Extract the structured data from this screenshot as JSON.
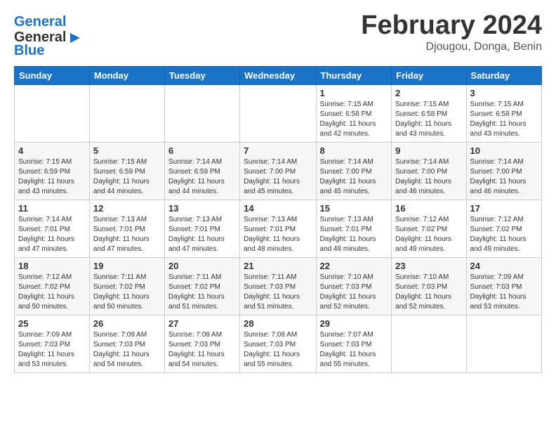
{
  "header": {
    "logo_general": "General",
    "logo_blue": "Blue",
    "month_title": "February 2024",
    "location": "Djougou, Donga, Benin"
  },
  "calendar": {
    "days_of_week": [
      "Sunday",
      "Monday",
      "Tuesday",
      "Wednesday",
      "Thursday",
      "Friday",
      "Saturday"
    ],
    "weeks": [
      [
        {
          "day": "",
          "info": ""
        },
        {
          "day": "",
          "info": ""
        },
        {
          "day": "",
          "info": ""
        },
        {
          "day": "",
          "info": ""
        },
        {
          "day": "1",
          "info": "Sunrise: 7:15 AM\nSunset: 6:58 PM\nDaylight: 11 hours and 42 minutes."
        },
        {
          "day": "2",
          "info": "Sunrise: 7:15 AM\nSunset: 6:58 PM\nDaylight: 11 hours and 43 minutes."
        },
        {
          "day": "3",
          "info": "Sunrise: 7:15 AM\nSunset: 6:58 PM\nDaylight: 11 hours and 43 minutes."
        }
      ],
      [
        {
          "day": "4",
          "info": "Sunrise: 7:15 AM\nSunset: 6:59 PM\nDaylight: 11 hours and 43 minutes."
        },
        {
          "day": "5",
          "info": "Sunrise: 7:15 AM\nSunset: 6:59 PM\nDaylight: 11 hours and 44 minutes."
        },
        {
          "day": "6",
          "info": "Sunrise: 7:14 AM\nSunset: 6:59 PM\nDaylight: 11 hours and 44 minutes."
        },
        {
          "day": "7",
          "info": "Sunrise: 7:14 AM\nSunset: 7:00 PM\nDaylight: 11 hours and 45 minutes."
        },
        {
          "day": "8",
          "info": "Sunrise: 7:14 AM\nSunset: 7:00 PM\nDaylight: 11 hours and 45 minutes."
        },
        {
          "day": "9",
          "info": "Sunrise: 7:14 AM\nSunset: 7:00 PM\nDaylight: 11 hours and 46 minutes."
        },
        {
          "day": "10",
          "info": "Sunrise: 7:14 AM\nSunset: 7:00 PM\nDaylight: 11 hours and 46 minutes."
        }
      ],
      [
        {
          "day": "11",
          "info": "Sunrise: 7:14 AM\nSunset: 7:01 PM\nDaylight: 11 hours and 47 minutes."
        },
        {
          "day": "12",
          "info": "Sunrise: 7:13 AM\nSunset: 7:01 PM\nDaylight: 11 hours and 47 minutes."
        },
        {
          "day": "13",
          "info": "Sunrise: 7:13 AM\nSunset: 7:01 PM\nDaylight: 11 hours and 47 minutes."
        },
        {
          "day": "14",
          "info": "Sunrise: 7:13 AM\nSunset: 7:01 PM\nDaylight: 11 hours and 48 minutes."
        },
        {
          "day": "15",
          "info": "Sunrise: 7:13 AM\nSunset: 7:01 PM\nDaylight: 11 hours and 48 minutes."
        },
        {
          "day": "16",
          "info": "Sunrise: 7:12 AM\nSunset: 7:02 PM\nDaylight: 11 hours and 49 minutes."
        },
        {
          "day": "17",
          "info": "Sunrise: 7:12 AM\nSunset: 7:02 PM\nDaylight: 11 hours and 49 minutes."
        }
      ],
      [
        {
          "day": "18",
          "info": "Sunrise: 7:12 AM\nSunset: 7:02 PM\nDaylight: 11 hours and 50 minutes."
        },
        {
          "day": "19",
          "info": "Sunrise: 7:11 AM\nSunset: 7:02 PM\nDaylight: 11 hours and 50 minutes."
        },
        {
          "day": "20",
          "info": "Sunrise: 7:11 AM\nSunset: 7:02 PM\nDaylight: 11 hours and 51 minutes."
        },
        {
          "day": "21",
          "info": "Sunrise: 7:11 AM\nSunset: 7:03 PM\nDaylight: 11 hours and 51 minutes."
        },
        {
          "day": "22",
          "info": "Sunrise: 7:10 AM\nSunset: 7:03 PM\nDaylight: 11 hours and 52 minutes."
        },
        {
          "day": "23",
          "info": "Sunrise: 7:10 AM\nSunset: 7:03 PM\nDaylight: 11 hours and 52 minutes."
        },
        {
          "day": "24",
          "info": "Sunrise: 7:09 AM\nSunset: 7:03 PM\nDaylight: 11 hours and 53 minutes."
        }
      ],
      [
        {
          "day": "25",
          "info": "Sunrise: 7:09 AM\nSunset: 7:03 PM\nDaylight: 11 hours and 53 minutes."
        },
        {
          "day": "26",
          "info": "Sunrise: 7:09 AM\nSunset: 7:03 PM\nDaylight: 11 hours and 54 minutes."
        },
        {
          "day": "27",
          "info": "Sunrise: 7:08 AM\nSunset: 7:03 PM\nDaylight: 11 hours and 54 minutes."
        },
        {
          "day": "28",
          "info": "Sunrise: 7:08 AM\nSunset: 7:03 PM\nDaylight: 11 hours and 55 minutes."
        },
        {
          "day": "29",
          "info": "Sunrise: 7:07 AM\nSunset: 7:03 PM\nDaylight: 11 hours and 55 minutes."
        },
        {
          "day": "",
          "info": ""
        },
        {
          "day": "",
          "info": ""
        }
      ]
    ]
  }
}
